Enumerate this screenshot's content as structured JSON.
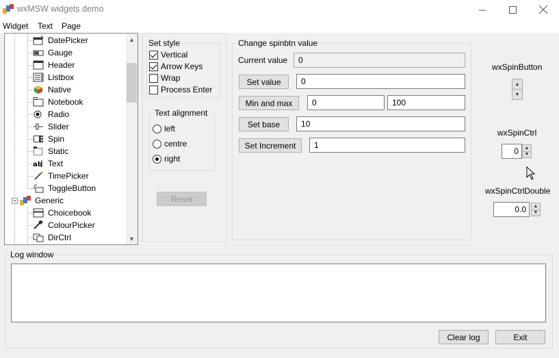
{
  "window": {
    "title": "wxMSW widgets demo",
    "minimize": "—",
    "maximize": "☐",
    "close": "✕"
  },
  "menubar": [
    "Widget",
    "Text",
    "Page"
  ],
  "tree": {
    "items": [
      {
        "label": "DatePicker",
        "icon": "datepicker-icon"
      },
      {
        "label": "Gauge",
        "icon": "gauge-icon"
      },
      {
        "label": "Header",
        "icon": "header-icon"
      },
      {
        "label": "Listbox",
        "icon": "listbox-icon"
      },
      {
        "label": "Native",
        "icon": "native-icon"
      },
      {
        "label": "Notebook",
        "icon": "notebook-icon"
      },
      {
        "label": "Radio",
        "icon": "radio-icon"
      },
      {
        "label": "Slider",
        "icon": "slider-icon"
      },
      {
        "label": "Spin",
        "icon": "spin-icon"
      },
      {
        "label": "Static",
        "icon": "static-icon"
      },
      {
        "label": "Text",
        "icon": "text-icon"
      },
      {
        "label": "TimePicker",
        "icon": "timepicker-icon"
      },
      {
        "label": "ToggleButton",
        "icon": "togglebutton-icon"
      },
      {
        "label": "Generic",
        "icon": "generic-icon",
        "expander": "−"
      },
      {
        "label": "Choicebook",
        "icon": "choicebook-icon"
      },
      {
        "label": "ColourPicker",
        "icon": "colourpicker-icon"
      },
      {
        "label": "DirCtrl",
        "icon": "dirctrl-icon"
      }
    ]
  },
  "set_style": {
    "label": "Set style",
    "options": [
      {
        "label": "Vertical",
        "checked": true
      },
      {
        "label": "Arrow Keys",
        "checked": true
      },
      {
        "label": "Wrap",
        "checked": false
      },
      {
        "label": "Process Enter",
        "checked": false
      }
    ]
  },
  "text_alignment": {
    "label": "Text alignment",
    "options": [
      {
        "label": "left",
        "selected": false
      },
      {
        "label": "centre",
        "selected": false
      },
      {
        "label": "right",
        "selected": true
      }
    ]
  },
  "reset_label": "Reset",
  "spinbtn": {
    "label": "Change spinbtn value",
    "current_label": "Current value",
    "current_value": "0",
    "set_value_label": "Set value",
    "set_value": "0",
    "minmax_label": "Min and max",
    "min": "0",
    "max": "100",
    "set_base_label": "Set base",
    "base": "10",
    "set_increment_label": "Set Increment",
    "increment": "1"
  },
  "right_panel": {
    "spinbutton_label": "wxSpinButton",
    "spinctrl_label": "wxSpinCtrl",
    "spinctrl_value": "0",
    "spinctrldouble_label": "wxSpinCtrlDouble",
    "spinctrldouble_value": "0.0",
    "up": "▲",
    "down": "▼"
  },
  "log": {
    "label": "Log window",
    "content": "",
    "clear_label": "Clear log",
    "exit_label": "Exit"
  }
}
